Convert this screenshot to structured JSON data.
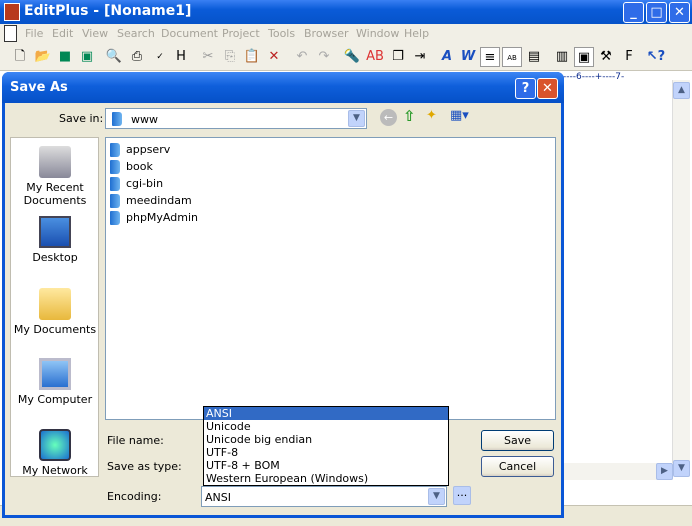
{
  "window": {
    "title": "EditPlus - [Noname1]"
  },
  "menu": [
    "File",
    "Edit",
    "View",
    "Search",
    "Document",
    "Project",
    "Tools",
    "Browser",
    "Window",
    "Help"
  ],
  "ruler": "----6----+----7-",
  "dialog": {
    "title": "Save As",
    "save_in_label": "Save in:",
    "save_in_value": "www",
    "places": [
      "My Recent Documents",
      "Desktop",
      "My Documents",
      "My Computer",
      "My Network"
    ],
    "files": [
      "appserv",
      "book",
      "cgi-bin",
      "meedindam",
      "phpMyAdmin"
    ],
    "file_name_label": "File name:",
    "save_as_type_label": "Save as type:",
    "encoding_label": "Encoding:",
    "encoding_value": "ANSI",
    "encoding_options": [
      "ANSI",
      "Unicode",
      "Unicode big endian",
      "UTF-8",
      "UTF-8 + BOM",
      "Western European (Windows)"
    ],
    "save_button": "Save",
    "cancel_button": "Cancel",
    "more_button": "..."
  }
}
